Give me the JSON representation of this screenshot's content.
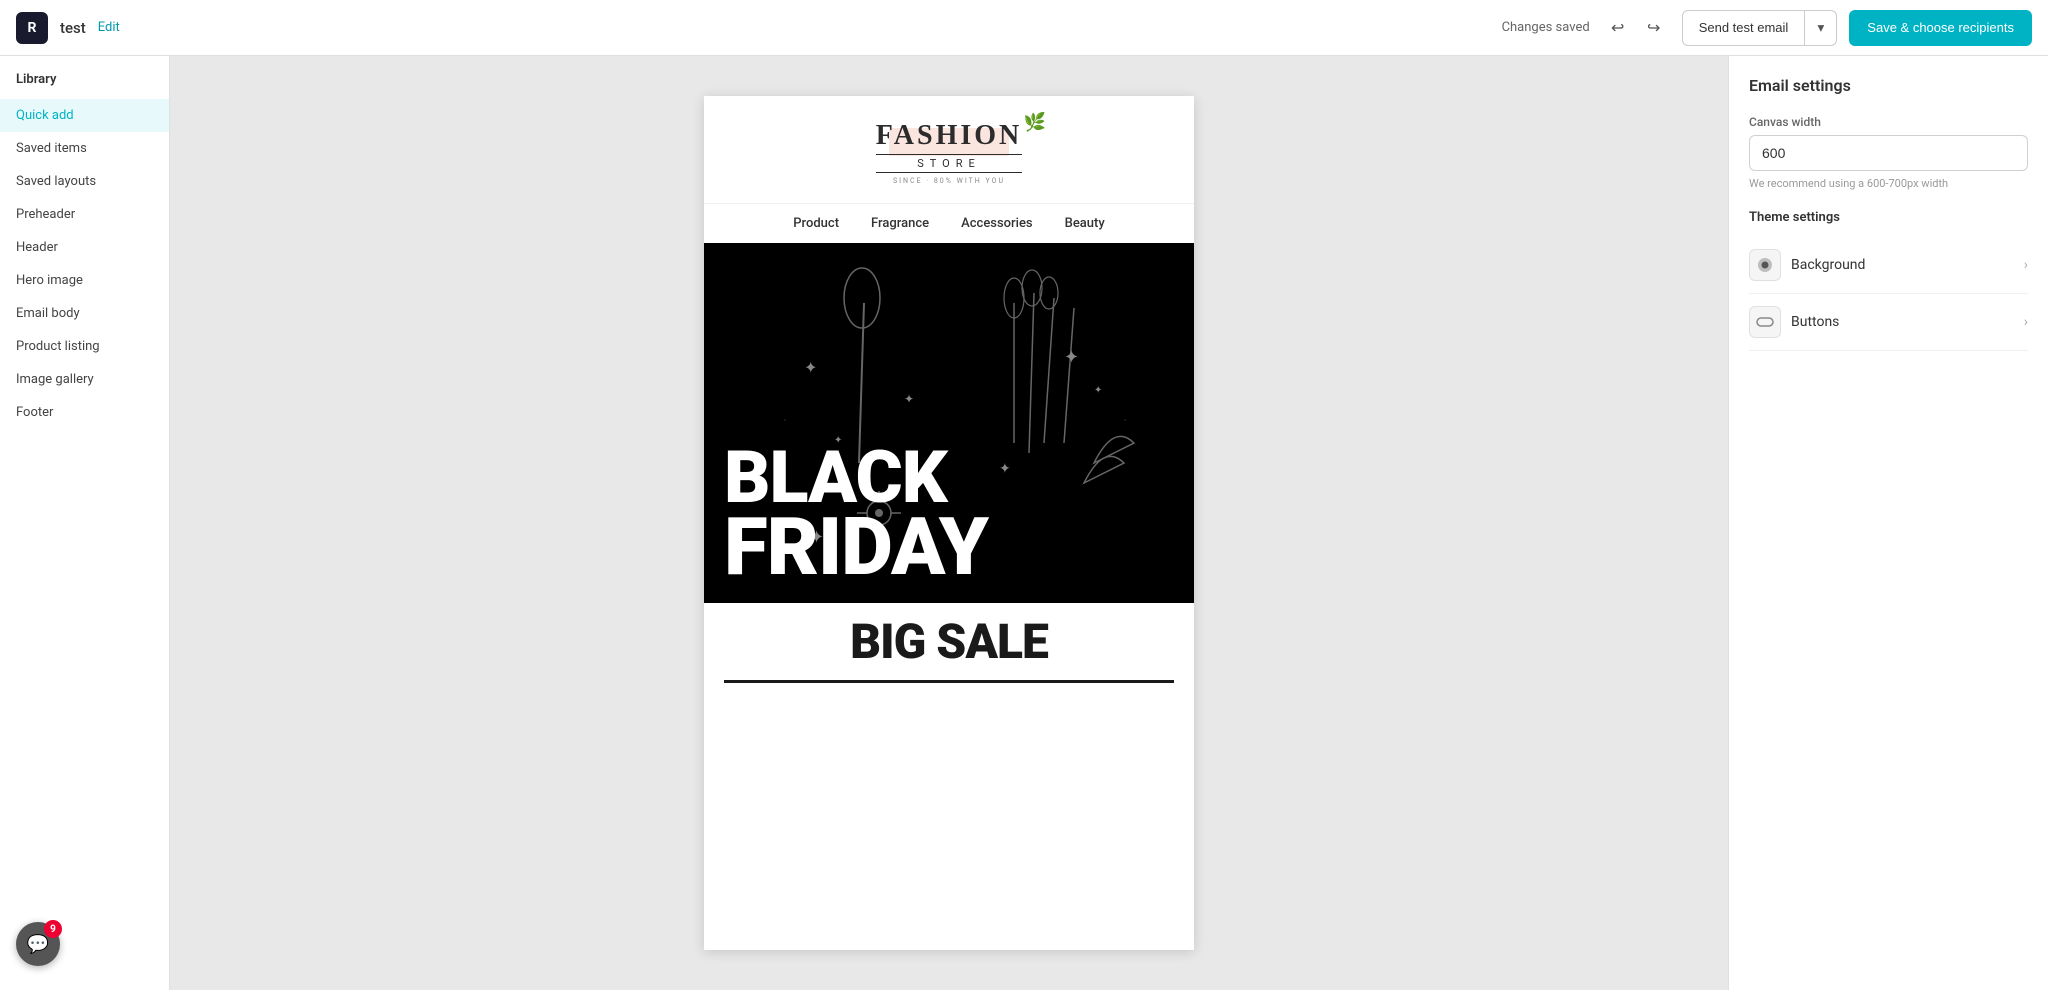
{
  "topbar": {
    "logo_text": "R",
    "project_name": "test",
    "edit_label": "Edit",
    "status": "Changes saved",
    "undo_icon": "↩",
    "redo_icon": "↪",
    "send_test_label": "Send test email",
    "save_label": "Save & choose recipients"
  },
  "sidebar": {
    "section_title": "Library",
    "items": [
      {
        "id": "quick-add",
        "label": "Quick add"
      },
      {
        "id": "saved-items",
        "label": "Saved items"
      },
      {
        "id": "saved-layouts",
        "label": "Saved layouts"
      },
      {
        "id": "preheader",
        "label": "Preheader"
      },
      {
        "id": "header",
        "label": "Header"
      },
      {
        "id": "hero-image",
        "label": "Hero image"
      },
      {
        "id": "email-body",
        "label": "Email body"
      },
      {
        "id": "product-listing",
        "label": "Product listing"
      },
      {
        "id": "image-gallery",
        "label": "Image gallery"
      },
      {
        "id": "footer",
        "label": "Footer"
      }
    ]
  },
  "email": {
    "logo_fashion": "FASHION",
    "logo_store": "STORE",
    "logo_tagline": "SINCE · 80% WITH YOU",
    "nav_items": [
      "Product",
      "Fragrance",
      "Accessories",
      "Beauty"
    ],
    "hero_line1": "BLACK",
    "hero_line2": "FRIDAY",
    "big_sale": "BIG SALE"
  },
  "right_panel": {
    "title": "Email settings",
    "canvas_width_label": "Canvas width",
    "canvas_width_value": "600",
    "canvas_width_hint": "We recommend using a 600-700px width",
    "theme_settings_label": "Theme settings",
    "background_label": "Background",
    "buttons_label": "Buttons"
  },
  "chat": {
    "badge": "9"
  }
}
